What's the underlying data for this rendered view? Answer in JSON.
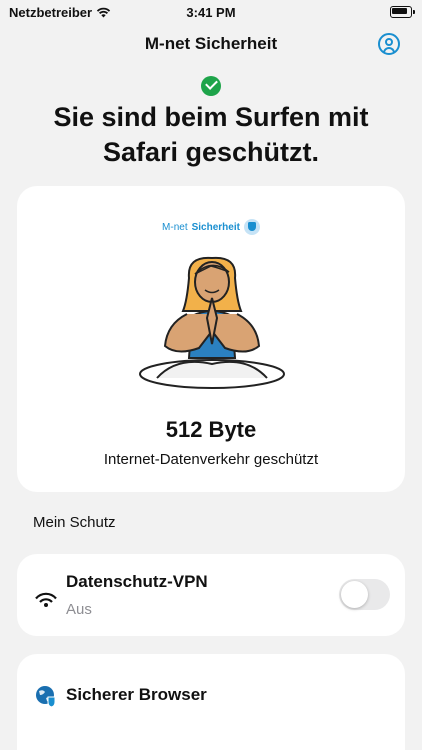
{
  "status_bar": {
    "carrier": "Netzbetreiber",
    "time": "3:41 PM"
  },
  "nav": {
    "title": "M-net Sicherheit"
  },
  "headline": "Sie sind beim Surfen mit Safari geschützt.",
  "hero": {
    "brand_prefix": "M-net",
    "brand_name": "Sicherheit",
    "bytes": "512 Byte",
    "bytes_caption": "Internet-Datenverkehr geschützt"
  },
  "section_label": "Mein Schutz",
  "vpn": {
    "title": "Datenschutz-VPN",
    "status": "Aus",
    "enabled": false
  },
  "browser": {
    "title": "Sicherer Browser"
  },
  "colors": {
    "accent": "#1a8fd0",
    "success": "#1ea44a",
    "background": "#f2f2f2"
  },
  "icons": [
    "wifi-icon",
    "battery-icon",
    "profile-icon",
    "checkmark-icon",
    "shield-icon",
    "vpn-signal-icon",
    "globe-shield-icon"
  ]
}
